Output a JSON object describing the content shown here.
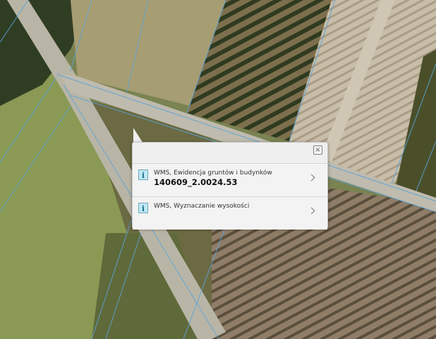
{
  "map": {
    "description_layer": "orthophoto"
  },
  "popup": {
    "close_symbol": "☒",
    "results": [
      {
        "source": "WMS, Ewidencja gruntów i budynków",
        "value": "140609_2.0024.53"
      },
      {
        "source": "WMS, Wyznaczanie wysokości",
        "value": ""
      }
    ]
  }
}
